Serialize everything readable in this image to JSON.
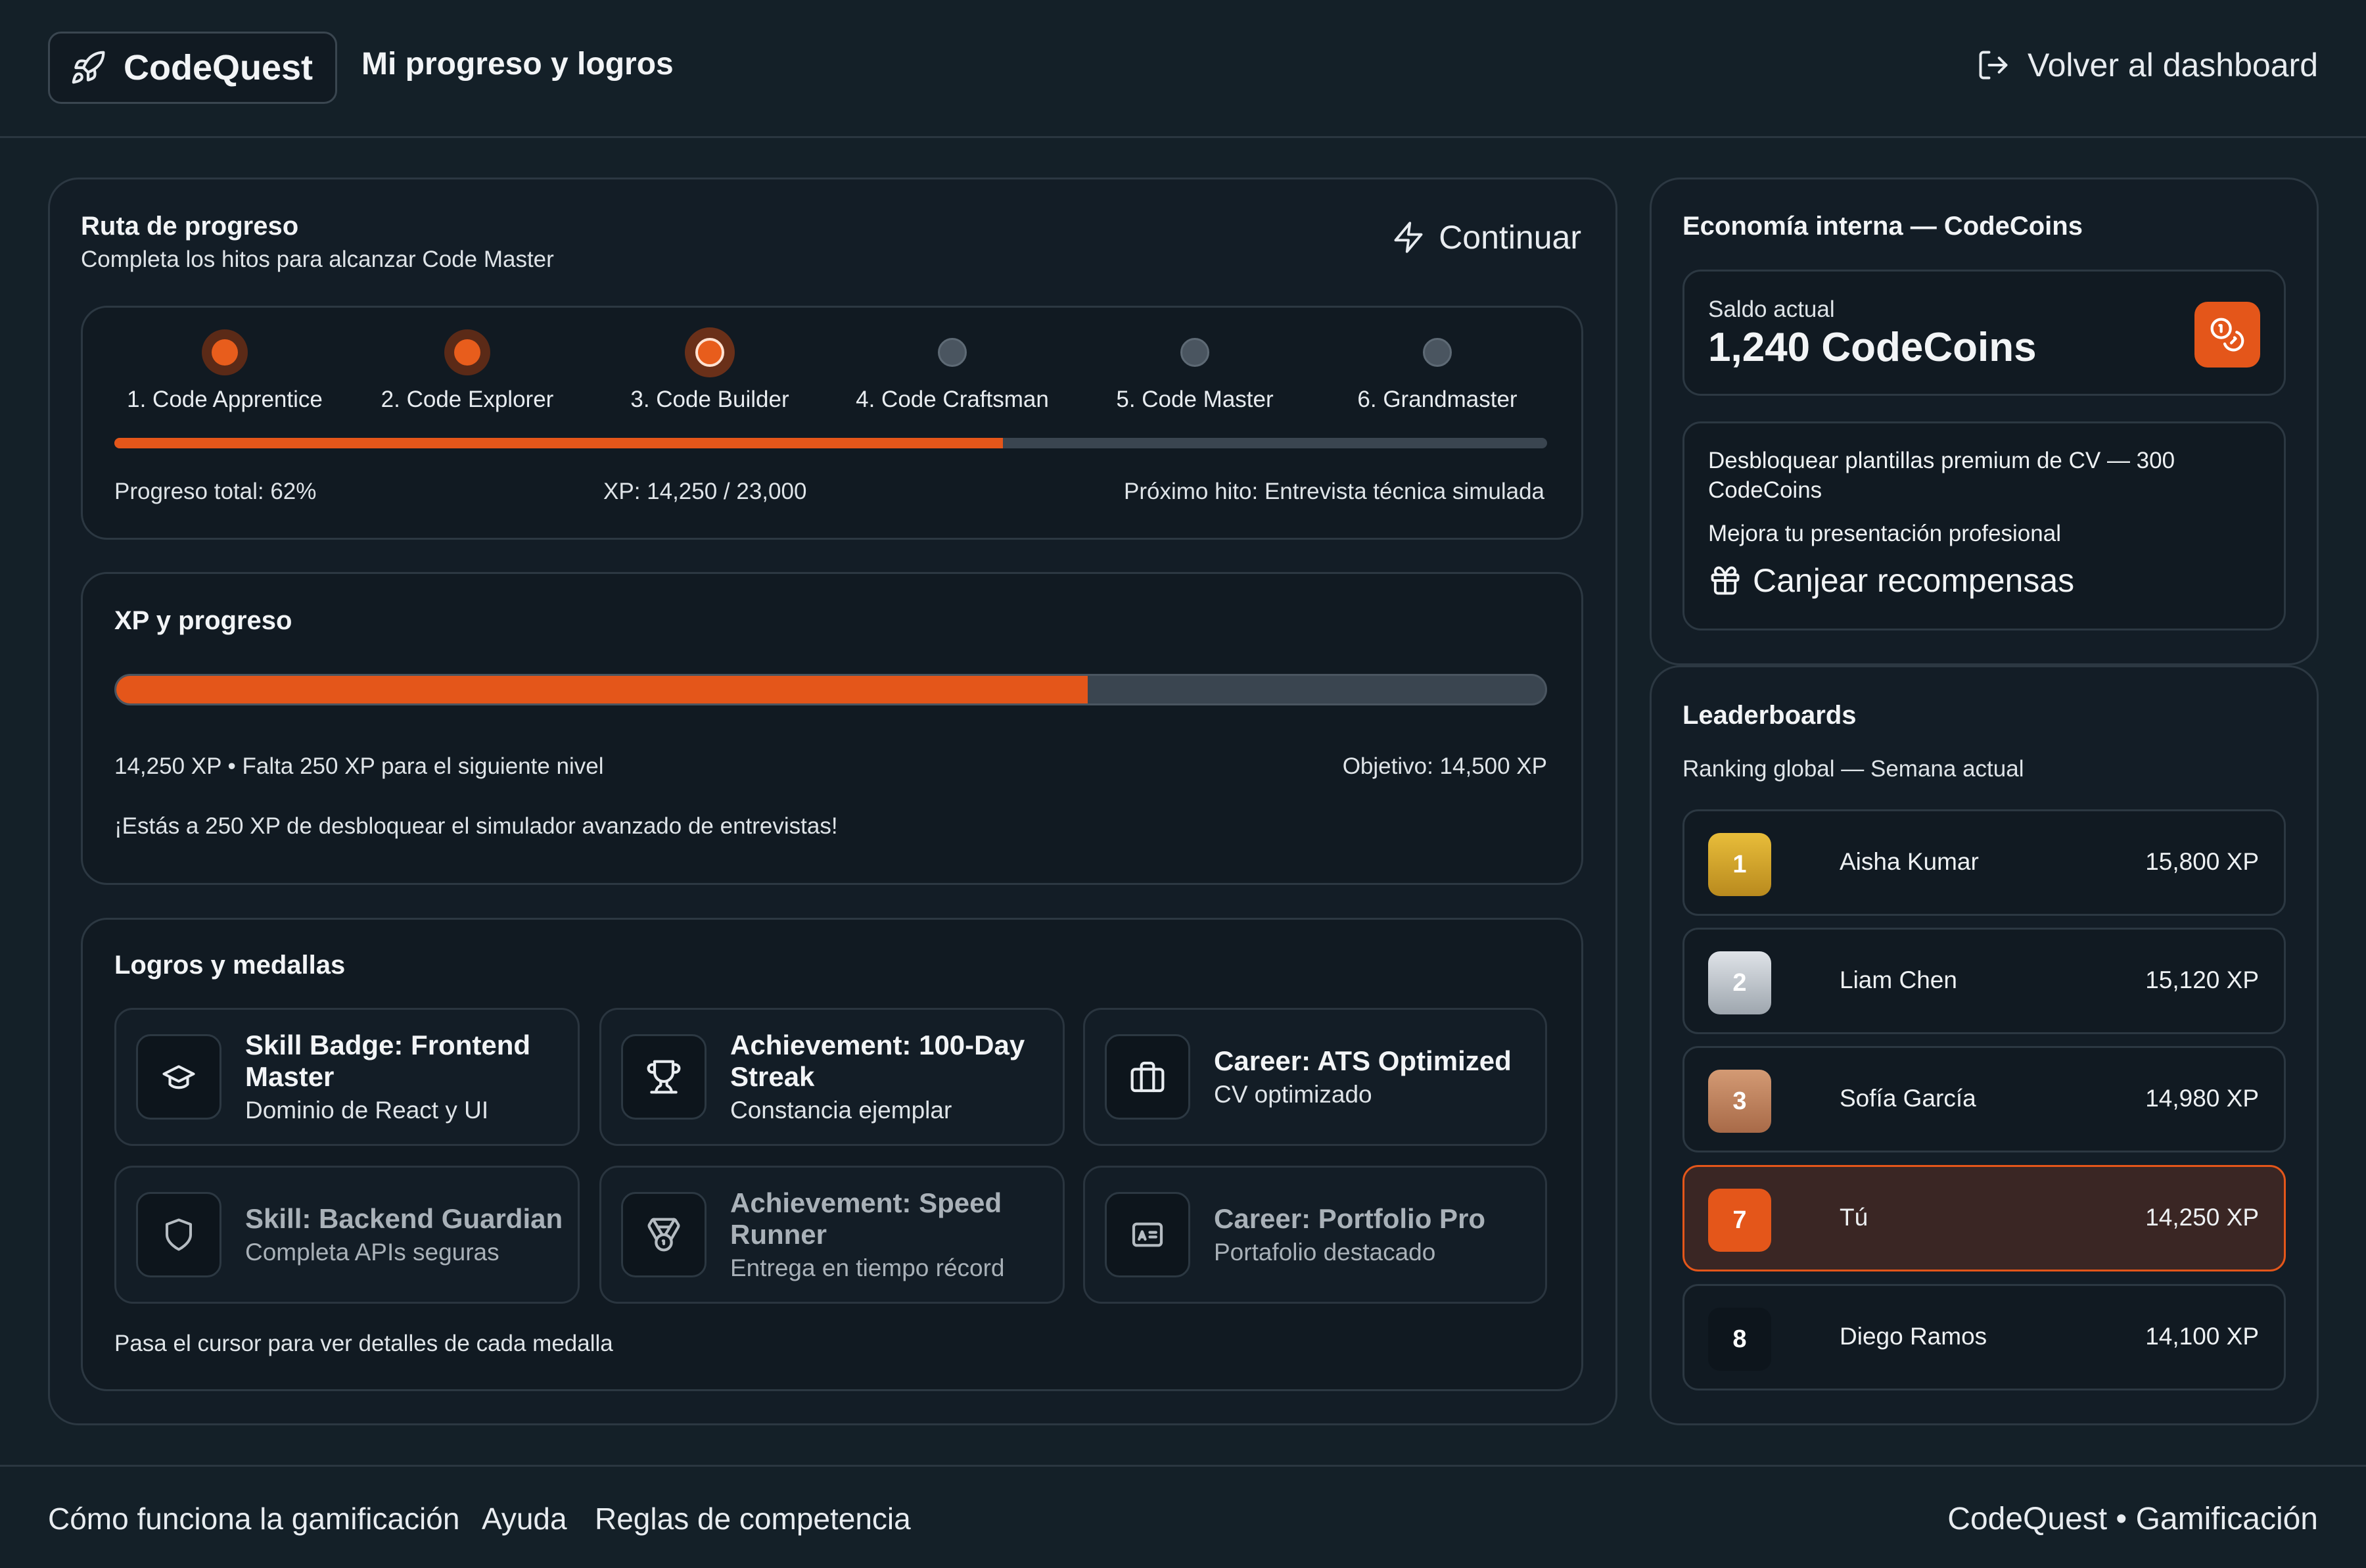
{
  "header": {
    "brand": "CodeQuest",
    "page_title": "Mi progreso y logros",
    "back_label": "Volver al dashboard"
  },
  "route": {
    "title": "Ruta de progreso",
    "subtitle": "Completa los hitos para alcanzar Code Master",
    "continue_label": "Continuar",
    "steps": [
      {
        "label": "1. Code Apprentice",
        "state": "done"
      },
      {
        "label": "2. Code Explorer",
        "state": "done"
      },
      {
        "label": "3. Code Builder",
        "state": "current"
      },
      {
        "label": "4. Code Craftsman",
        "state": "locked"
      },
      {
        "label": "5. Code Master",
        "state": "locked"
      },
      {
        "label": "6. Grandmaster",
        "state": "locked"
      }
    ],
    "progress_fraction": 0.62,
    "total_label": "Progreso total: 62%",
    "xp_label": "XP: 14,250 / 23,000",
    "next_label": "Próximo hito: Entrevista técnica simulada"
  },
  "xp": {
    "title": "XP y progreso",
    "progress_fraction": 0.68,
    "status_label": "14,250 XP • Falta 250 XP para el siguiente nivel",
    "goal_label": "Objetivo: 14,500 XP",
    "message": "¡Estás a 250 XP de desbloquear el simulador avanzado de entrevistas!"
  },
  "medals": {
    "title": "Logros y medallas",
    "items": [
      {
        "title": "Skill Badge: Frontend Master",
        "desc": "Dominio de React y UI",
        "icon": "graduation-cap-icon",
        "locked": false
      },
      {
        "title": "Achievement: 100-Day Streak",
        "desc": "Constancia ejemplar",
        "icon": "trophy-icon",
        "locked": false
      },
      {
        "title": "Career: ATS Optimized",
        "desc": "CV optimizado",
        "icon": "briefcase-icon",
        "locked": false
      },
      {
        "title": "Skill: Backend Guardian",
        "desc": "Completa APIs seguras",
        "icon": "shield-icon",
        "locked": true
      },
      {
        "title": "Achievement: Speed Runner",
        "desc": "Entrega en tiempo récord",
        "icon": "medal-icon",
        "locked": true
      },
      {
        "title": "Career: Portfolio Pro",
        "desc": "Portafolio destacado",
        "icon": "id-card-icon",
        "locked": true
      }
    ],
    "hint": "Pasa el cursor para ver detalles de cada medalla"
  },
  "economy": {
    "title": "Economía interna — CodeCoins",
    "balance_label": "Saldo actual",
    "balance_value": "1,240 CodeCoins",
    "reward_title": "Desbloquear plantillas premium de CV — 300 CodeCoins",
    "reward_desc": "Mejora tu presentación profesional",
    "redeem_label": "Canjear recompensas"
  },
  "leaderboard": {
    "title": "Leaderboards",
    "subtitle": "Ranking global — Semana actual",
    "rows": [
      {
        "rank": "1",
        "name": "Aisha Kumar",
        "xp": "15,800 XP",
        "color": "#d9a92a"
      },
      {
        "rank": "2",
        "name": "Liam Chen",
        "xp": "15,120 XP",
        "color": "#b9c0c8"
      },
      {
        "rank": "3",
        "name": "Sofía García",
        "xp": "14,980 XP",
        "color": "#c08461"
      },
      {
        "rank": "7",
        "name": "Tú",
        "xp": "14,250 XP",
        "color": "#e4561a",
        "me": true
      },
      {
        "rank": "8",
        "name": "Diego Ramos",
        "xp": "14,100 XP",
        "color": "#0d151c"
      }
    ]
  },
  "footer": {
    "links": [
      "Cómo funciona la gamificación",
      "Ayuda",
      "Reglas de competencia"
    ],
    "tagline": "CodeQuest • Gamificación"
  },
  "colors": {
    "accent": "#e4561a",
    "background": "#142028"
  }
}
